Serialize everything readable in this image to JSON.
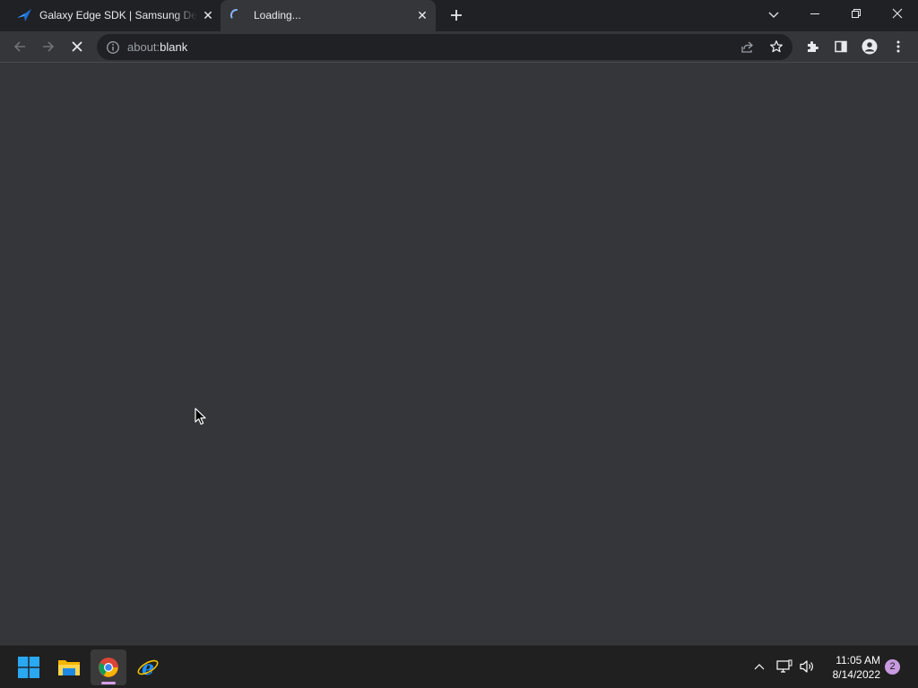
{
  "browser": {
    "tabs": [
      {
        "title": "Galaxy Edge SDK | Samsung Developers",
        "close_label": "✕",
        "active": false
      },
      {
        "title": "Loading...",
        "close_label": "✕",
        "active": true
      }
    ],
    "new_tab_label": "+",
    "address": {
      "scheme": "about:",
      "path": "blank"
    }
  },
  "taskbar": {
    "apps": [
      "windows-start",
      "file-explorer",
      "google-chrome",
      "internet-explorer"
    ],
    "clock": {
      "time": "11:05 AM",
      "date": "8/14/2022"
    },
    "notification_count": "2"
  },
  "colors": {
    "titlebar": "#202124",
    "toolbar": "#35363a",
    "omnibox": "#202124",
    "content": "#35363a",
    "taskbar": "#202020",
    "accent": "#d79fe8"
  }
}
